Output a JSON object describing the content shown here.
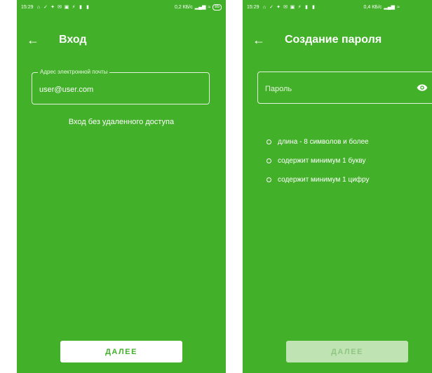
{
  "colors": {
    "primary_green": "#43b02a",
    "white": "#ffffff",
    "disabled_button": "#bfe3b3"
  },
  "screen_login": {
    "status": {
      "time": "15:29",
      "net_speed": "0,2 КБ/с",
      "battery": "85",
      "icons": [
        "home-icon",
        "check-icon",
        "settings-icon",
        "mail-icon",
        "image-icon",
        "bolt-icon",
        "trash-icon",
        "trash-icon",
        "wifi-icon",
        "signal-icon"
      ]
    },
    "title": "Вход",
    "email_label": "Адрес электронной почты",
    "email_value": "user@user.com",
    "no_remote_link": "Вход без удаленного доступа",
    "next_button": "ДАЛЕЕ"
  },
  "screen_password": {
    "status": {
      "time": "15:29",
      "net_speed": "0,4 КБ/с"
    },
    "title": "Создание пароля",
    "password_placeholder": "Пароль",
    "rules": [
      "длина - 8 символов и более",
      "содержит минимум 1 букву",
      "содержит минимум 1 цифру"
    ],
    "next_button": "ДАЛЕЕ"
  }
}
